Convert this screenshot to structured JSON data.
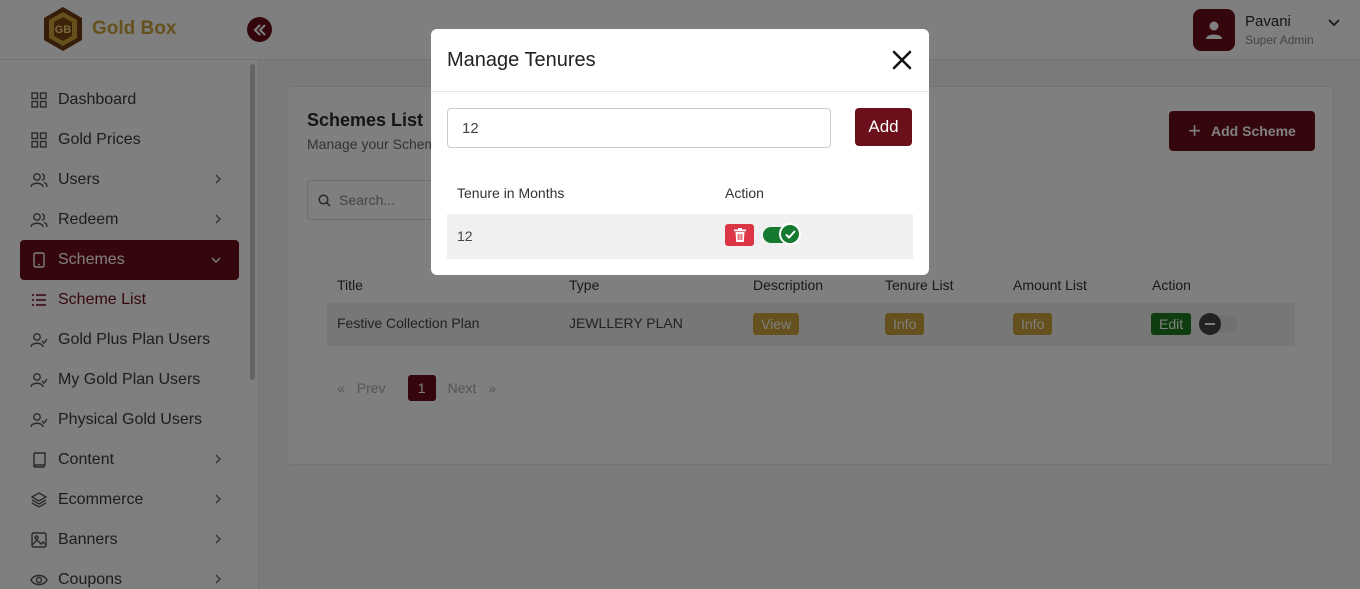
{
  "app": {
    "name": "Gold Box"
  },
  "user": {
    "name": "Pavani",
    "role": "Super Admin"
  },
  "sidebar": {
    "items": [
      {
        "label": "Dashboard"
      },
      {
        "label": "Gold Prices"
      },
      {
        "label": "Users"
      },
      {
        "label": "Redeem"
      },
      {
        "label": "Schemes"
      },
      {
        "label": "Scheme List"
      },
      {
        "label": "Gold Plus Plan Users"
      },
      {
        "label": "My Gold Plan Users"
      },
      {
        "label": "Physical Gold Users"
      },
      {
        "label": "Content"
      },
      {
        "label": "Ecommerce"
      },
      {
        "label": "Banners"
      },
      {
        "label": "Coupons"
      }
    ]
  },
  "main": {
    "title": "Schemes List",
    "subtitle": "Manage your Schem",
    "add_button": "Add Scheme",
    "search_placeholder": "Search...",
    "table": {
      "headers": [
        "Title",
        "Type",
        "Description",
        "Tenure List",
        "Amount List",
        "Action"
      ],
      "rows": [
        {
          "title": "Festive Collection Plan",
          "type": "JEWLLERY PLAN",
          "description": "View",
          "tenure": "Info",
          "amount": "Info",
          "edit": "Edit"
        }
      ]
    },
    "pagination": {
      "prev": "Prev",
      "current": "1",
      "next": "Next",
      "first": "«",
      "last": "»"
    }
  },
  "modal": {
    "title": "Manage Tenures",
    "input_value": "12",
    "add_label": "Add",
    "headers": [
      "Tenure in Months",
      "Action"
    ],
    "rows": [
      {
        "months": "12"
      }
    ]
  },
  "colors": {
    "brand": "#6b0f1a",
    "gold": "#c9a23a",
    "success": "#157a2f",
    "danger": "#dc3545"
  }
}
